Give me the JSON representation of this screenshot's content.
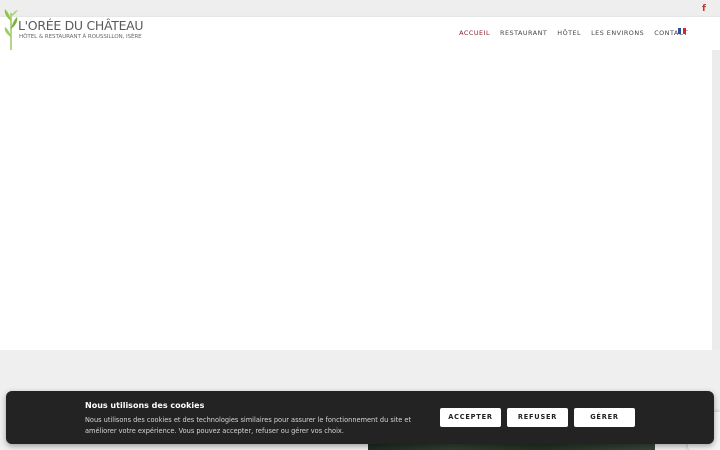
{
  "topbar": {
    "social_icon": "facebook-icon",
    "social_label": "f"
  },
  "logo": {
    "title": "L'ORÉE DU CHÂTEAU",
    "subtitle": "HÔTEL & RESTAURANT À ROUSSILLON, ISÈRE"
  },
  "nav": {
    "items": [
      {
        "label": "ACCUEIL",
        "active": true
      },
      {
        "label": "RESTAURANT",
        "active": false
      },
      {
        "label": "HÔTEL",
        "active": false
      },
      {
        "label": "LES ENVIRONS",
        "active": false
      },
      {
        "label": "CONTACT",
        "active": false
      }
    ],
    "language_icon": "french-flag-icon"
  },
  "cookie_banner": {
    "title": "Nous utilisons des cookies",
    "text": "Nous utilisons des cookies et des technologies similaires pour assurer le fonctionnement du site et améliorer votre expérience. Vous pouvez accepter, refuser ou gérer vos choix.",
    "accept_label": "ACCEPTER",
    "refuse_label": "REFUSER",
    "manage_label": "GÉRER"
  },
  "colors": {
    "accent": "#8b1d2c",
    "banner_bg": "#232323",
    "leaf_green": "#8cc63f",
    "facebook": "#c0392b"
  }
}
